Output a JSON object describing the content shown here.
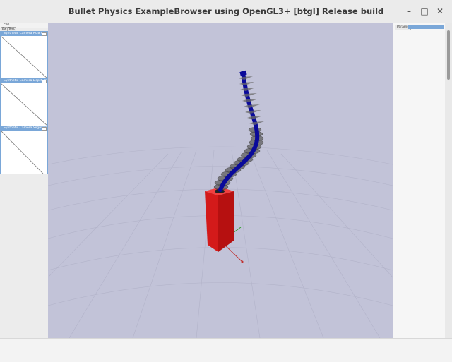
{
  "window": {
    "title": "Bullet Physics ExampleBrowser using OpenGL3+ [btgl] Release build",
    "minimize_icon": "minimize-icon",
    "maximize_icon": "maximize-icon",
    "close_icon": "close-icon"
  },
  "colors": {
    "viewport_bg": "#c2c3d8",
    "box_red": "#d41a1a",
    "rod_blue": "#0a0a9a",
    "panel_accent": "#7aa7d8"
  },
  "left_panel": {
    "menu_label": "File",
    "tabs": [
      "Ex",
      "Test"
    ],
    "windows": [
      {
        "title": "Synthetic Camera RGB data"
      },
      {
        "title": "Synthetic Camera Depth data"
      },
      {
        "title": "Synthetic Camera Segmentation Mask"
      }
    ]
  },
  "right_panel": {
    "tab_label": "Params"
  },
  "status": {
    "left_text": "",
    "right_text": ""
  }
}
